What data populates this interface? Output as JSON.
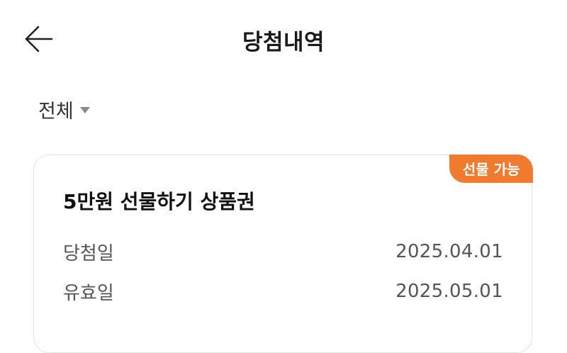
{
  "header": {
    "title": "당첨내역",
    "back_icon": "arrow-left-icon"
  },
  "filter": {
    "selected": "전체",
    "caret_icon": "caret-down-icon"
  },
  "prize_card": {
    "badge": "선물 가능",
    "title": "5만원 선물하기 상품권",
    "rows": [
      {
        "label": "당첨일",
        "value": "2025.04.01"
      },
      {
        "label": "유효일",
        "value": "2025.05.01"
      }
    ]
  },
  "colors": {
    "badge_bg": "#f07a2e",
    "text_primary": "#111111",
    "text_secondary": "#555555",
    "card_border": "#e2e2e2"
  }
}
